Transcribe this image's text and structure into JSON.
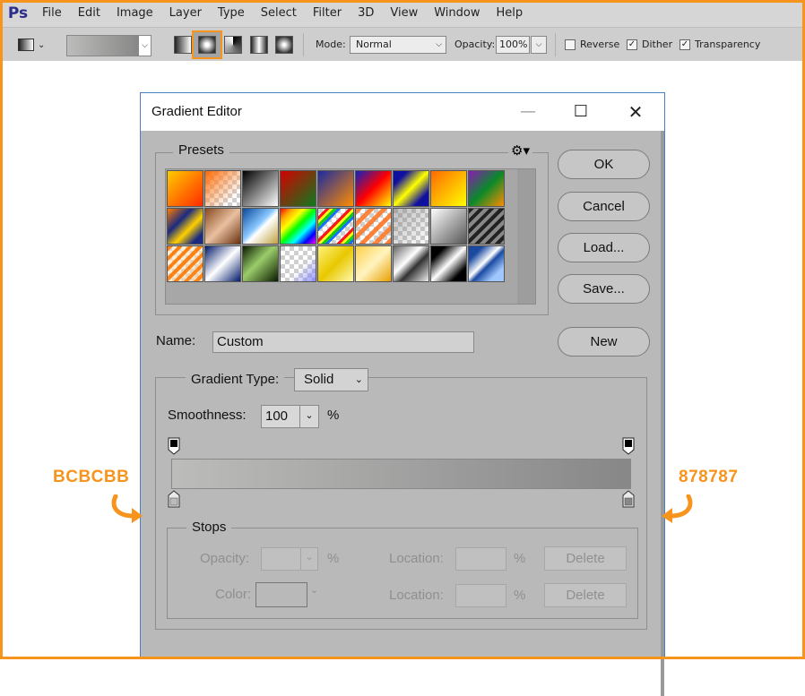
{
  "menu": [
    "Ps",
    "File",
    "Edit",
    "Image",
    "Layer",
    "Type",
    "Select",
    "Filter",
    "3D",
    "View",
    "Window",
    "Help"
  ],
  "options_bar": {
    "mode_label": "Mode:",
    "mode_value": "Normal",
    "opacity_label": "Opacity:",
    "opacity_value": "100%",
    "reverse_label": "Reverse",
    "reverse_checked": false,
    "dither_label": "Dither",
    "dither_checked": true,
    "transparency_label": "Transparency",
    "transparency_checked": true,
    "selected_gradient_type": "radial"
  },
  "dialog": {
    "title": "Gradient Editor",
    "presets_label": "Presets",
    "buttons": {
      "ok": "OK",
      "cancel": "Cancel",
      "load": "Load...",
      "save": "Save...",
      "new": "New"
    },
    "name_label": "Name:",
    "name_value": "Custom",
    "gradient_type_label": "Gradient Type:",
    "gradient_type_value": "Solid",
    "smoothness_label": "Smoothness:",
    "smoothness_value": "100",
    "smoothness_unit": "%",
    "start_color": "#bcbcbb",
    "end_color": "#878787",
    "stops": {
      "label": "Stops",
      "opacity_label": "Opacity:",
      "opacity_unit": "%",
      "location_label": "Location:",
      "location_unit": "%",
      "color_label": "Color:",
      "delete_label": "Delete"
    }
  },
  "callouts": {
    "left": "BCBCBB",
    "right": "878787"
  },
  "accent_color": "#f7941d"
}
